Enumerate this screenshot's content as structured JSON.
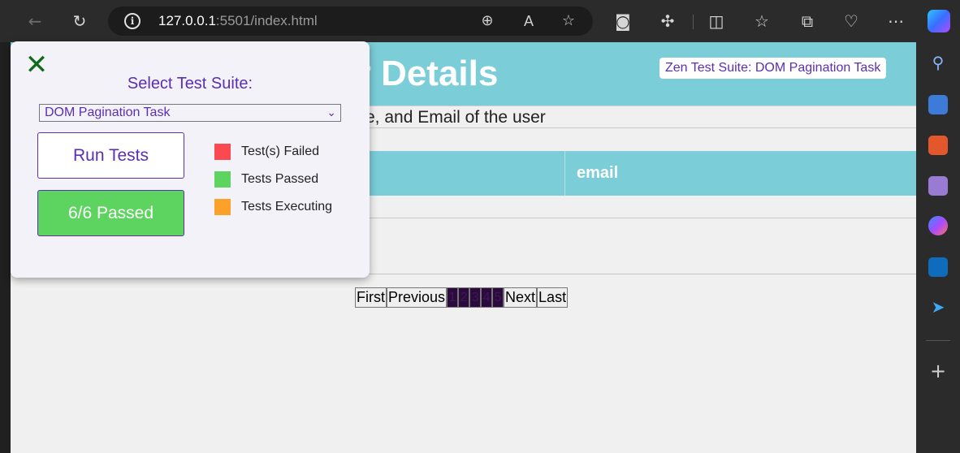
{
  "browser": {
    "url_host": "127.0.0.1",
    "url_path": ":5501/index.html"
  },
  "page": {
    "title": "User Details",
    "suite_badge": "Zen Test Suite: DOM Pagination Task",
    "subtitle": "e, and Email of the user",
    "table": {
      "columns": [
        "email"
      ]
    },
    "pagination": {
      "first": "First",
      "previous": "Previous",
      "pages": [
        "1",
        "2",
        "3",
        "4",
        "5"
      ],
      "next": "Next",
      "last": "Last"
    }
  },
  "zen_panel": {
    "select_label": "Select Test Suite:",
    "selected_suite": "DOM Pagination Task",
    "run_button": "Run Tests",
    "result_button": "6/6 Passed",
    "legend": [
      {
        "label": "Test(s) Failed",
        "color": "#fa4a4f"
      },
      {
        "label": "Tests Passed",
        "color": "#5dd45f"
      },
      {
        "label": "Tests Executing",
        "color": "#fca12a"
      }
    ]
  },
  "sidebar": {
    "icons": [
      "search-icon",
      "shopping-tag-icon",
      "toolbox-icon",
      "chess-icon",
      "copilot-m365-icon",
      "outlook-icon",
      "send-icon"
    ]
  }
}
